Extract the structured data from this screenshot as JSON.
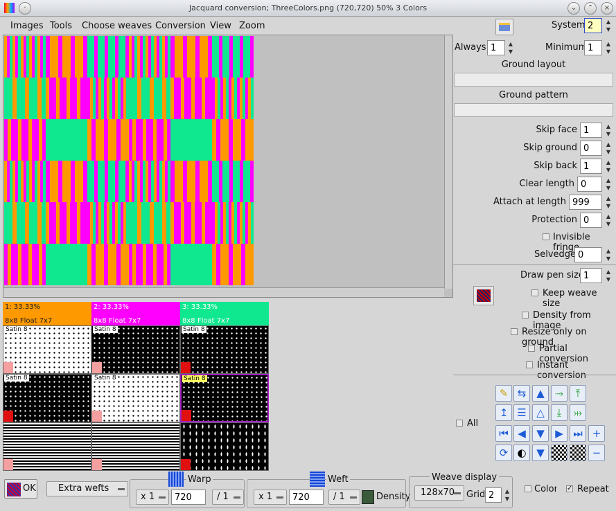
{
  "window": {
    "title": "Jacquard conversion; ThreeColors.png (720,720) 50% 3 Colors"
  },
  "menu": [
    "Images",
    "Tools",
    "Choose weaves",
    "Conversion",
    "View",
    "Zoom"
  ],
  "right": {
    "system_label": "System",
    "system_value": "2",
    "always_label": "Always",
    "always_value": "1",
    "minimum_label": "Minimum",
    "minimum_value": "1",
    "ground_layout_label": "Ground layout",
    "ground_layout_value": "",
    "ground_pattern_label": "Ground pattern",
    "ground_pattern_value": "",
    "fields": [
      {
        "label": "Skip face",
        "value": "1"
      },
      {
        "label": "Skip ground",
        "value": "0"
      },
      {
        "label": "Skip back",
        "value": "1"
      },
      {
        "label": "Clear length",
        "value": "0"
      },
      {
        "label": "Attach at length",
        "value": "999"
      },
      {
        "label": "Protection",
        "value": "0"
      }
    ],
    "invisible_fringe_label": "Invisible fringe",
    "selvedge_label": "Selvedge",
    "selvedge_value": "0",
    "draw_pen_label": "Draw pen size",
    "draw_pen_value": "1",
    "keep_weave_label": "Keep weave size",
    "density_label": "Density from image",
    "resize_label": "Resize only on ground",
    "partial_label": "Partial conversion",
    "instant_label": "Instant conversion",
    "all_label": "All"
  },
  "pattern": {
    "colors": {
      "orange": "#ff9900",
      "magenta": "#ff00ff",
      "green": "#10e890"
    }
  },
  "weaves": {
    "columns": [
      {
        "label": "1: 33.33%",
        "sub": "8x8 Float 7x7",
        "color": "#ff9900"
      },
      {
        "label": "2: 33.33%",
        "sub": "8x8 Float 7x7",
        "color": "#ff00ff"
      },
      {
        "label": "3: 33.33%",
        "sub": "8x8 Float 7x7",
        "color": "#10e890"
      }
    ],
    "cell_label": "Satin 8"
  },
  "bottom": {
    "ok_label": "OK",
    "extra_wefts_label": "Extra wefts",
    "warp_label": "Warp",
    "warp_mult": "x 1",
    "warp_value": "720",
    "warp_div": "/ 1",
    "weft_label": "Weft",
    "weft_mult": "x 1",
    "weft_value": "720",
    "weft_div": "/ 1",
    "density_label": "Density",
    "weave_display_label": "Weave display",
    "weave_display_value": "128x70",
    "grid_label": "Grid",
    "grid_value": "2",
    "color_label": "Color",
    "repeat_label": "Repeat"
  }
}
